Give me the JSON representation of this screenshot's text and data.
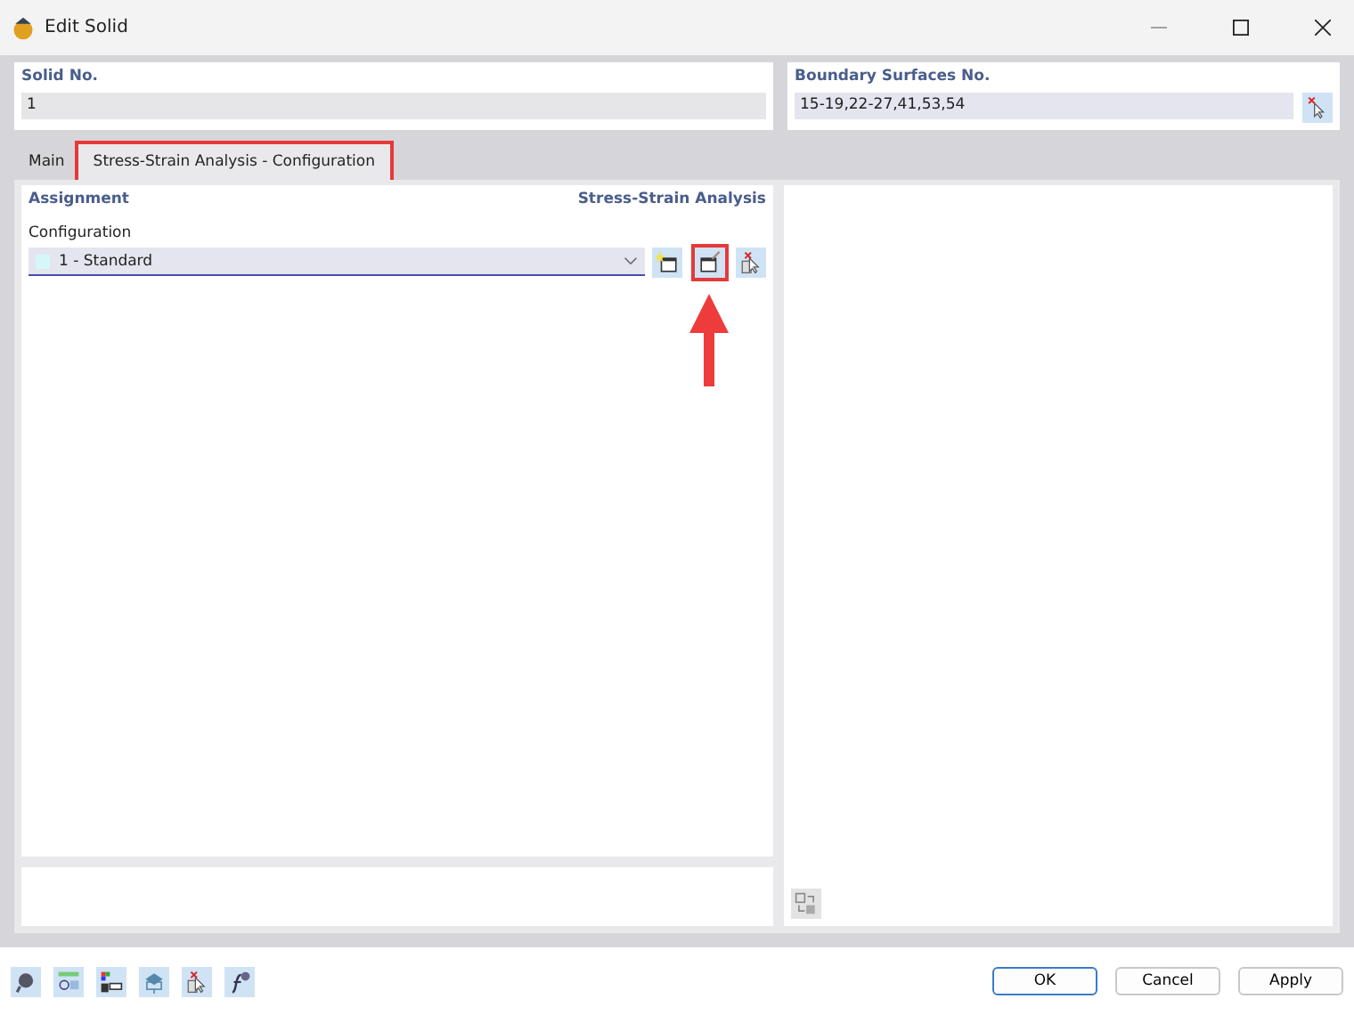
{
  "window": {
    "title": "Edit Solid"
  },
  "solid_no": {
    "label": "Solid No.",
    "value": "1"
  },
  "boundary_surfaces": {
    "label": "Boundary Surfaces No.",
    "value": "15-19,22-27,41,53,54"
  },
  "tabs": [
    {
      "label": "Main",
      "selected": false,
      "highlighted": false
    },
    {
      "label": "Stress-Strain Analysis - Configuration",
      "selected": true,
      "highlighted": true
    }
  ],
  "section": {
    "title": "Assignment",
    "subtitle": "Stress-Strain Analysis"
  },
  "configuration": {
    "label": "Configuration",
    "value": "1 - Standard"
  },
  "config_tools": [
    {
      "kind": "new",
      "highlighted": false,
      "arrow": false
    },
    {
      "kind": "edit",
      "highlighted": true,
      "arrow": true
    },
    {
      "kind": "pick",
      "highlighted": false,
      "arrow": false
    }
  ],
  "footer_tools": [
    {
      "kind": "help"
    },
    {
      "kind": "units"
    },
    {
      "kind": "display"
    },
    {
      "kind": "view"
    },
    {
      "kind": "pick"
    },
    {
      "kind": "formula"
    }
  ],
  "buttons": [
    {
      "label": "OK",
      "default": true
    },
    {
      "label": "Cancel",
      "default": false
    },
    {
      "label": "Apply",
      "default": false
    }
  ]
}
